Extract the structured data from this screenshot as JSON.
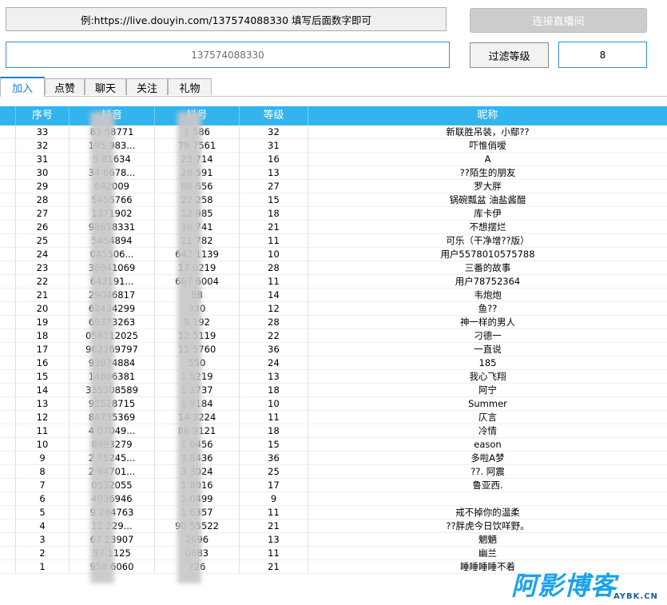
{
  "header": {
    "hint": "例:https://live.douyin.com/137574088330   填写后面数字即可",
    "connect_label": "连接直播间",
    "room_id": "137574088330",
    "filter_label": "过滤等级",
    "filter_level": "8"
  },
  "tabs": [
    {
      "label": "加入",
      "active": true
    },
    {
      "label": "点赞",
      "active": false
    },
    {
      "label": "聊天",
      "active": false
    },
    {
      "label": "关注",
      "active": false
    },
    {
      "label": "礼物",
      "active": false
    }
  ],
  "table": {
    "columns": [
      "序号",
      "抖音",
      "抖号",
      "等级",
      "昵称"
    ],
    "rows": [
      [
        "33",
        "83 58771",
        "1 586",
        "32",
        "新联胜吊装，小鄢??"
      ],
      [
        "32",
        "195 983...",
        "79 7561",
        "31",
        "吓惟俏嗳"
      ],
      [
        "31",
        "9 81634",
        "23 714",
        "16",
        "A"
      ],
      [
        "30",
        "34 6678...",
        "28 591",
        "13",
        "??陌生的朋友"
      ],
      [
        "29",
        "642009",
        "86 656",
        "27",
        "罗大胖"
      ],
      [
        "28",
        "5455766",
        "22 258",
        "15",
        "锅碗瓢盆 油盐酱醋"
      ],
      [
        "27",
        "1371902",
        "12 985",
        "18",
        "库卡伊"
      ],
      [
        "26",
        "98658331",
        "36 741",
        "21",
        "不想摆烂"
      ],
      [
        "25",
        "5454894",
        "21 782",
        "11",
        "可乐（干净增??版）"
      ],
      [
        "24",
        "045506...",
        "642 1139",
        "10",
        "用户5578010575788"
      ],
      [
        "23",
        "36941069",
        "17 0219",
        "28",
        "三番的故事"
      ],
      [
        "22",
        "642191...",
        "667 6004",
        "11",
        "用户78752364"
      ],
      [
        "21",
        "29046817",
        "88",
        "14",
        "韦炮炮"
      ],
      [
        "20",
        "62434299",
        "330",
        "12",
        "鱼??"
      ],
      [
        "19",
        "69373263",
        "9 192",
        "28",
        "神一样的男人"
      ],
      [
        "18",
        "058112025",
        "12 5119",
        "22",
        "刁德一"
      ],
      [
        "17",
        "962269797",
        "11 5760",
        "36",
        "一直说"
      ],
      [
        "16",
        "93974884",
        "550",
        "24",
        "185"
      ],
      [
        "15",
        "14606381",
        "1 5219",
        "13",
        "我心飞翔"
      ],
      [
        "14",
        "335308589",
        "1 1737",
        "18",
        "阿宁"
      ],
      [
        "13",
        "92528715",
        "1 9184",
        "10",
        "Summer"
      ],
      [
        "12",
        "84735369",
        "14 3224",
        "11",
        "仄言"
      ],
      [
        "11",
        "4 07049...",
        "86 9121",
        "18",
        "冷情"
      ],
      [
        "10",
        "8993279",
        "1 0456",
        "15",
        "eason"
      ],
      [
        "9",
        "2 75245...",
        "3 8436",
        "36",
        "多啦A梦"
      ],
      [
        "8",
        "2 94701...",
        "3 3024",
        "25",
        "??. 阿震"
      ],
      [
        "7",
        "0532055",
        "1 8016",
        "17",
        "鲁亚西."
      ],
      [
        "6",
        "4936946",
        "1 0499",
        "9",
        ""
      ],
      [
        "5",
        "9 284763",
        "1 6357",
        "11",
        "戒不掉你的温柔"
      ],
      [
        "4",
        "12 229...",
        "90 55522",
        "21",
        "??胖虎今日饮咩野。"
      ],
      [
        "3",
        "67 23907",
        "2696",
        "13",
        "魍魉"
      ],
      [
        "2",
        "97 1125",
        "0683",
        "11",
        "幽兰"
      ],
      [
        "1",
        "958 6060",
        "726",
        "21",
        "睡睡睡睡不着"
      ]
    ]
  },
  "watermark": {
    "main": "阿影博客",
    "sub": "AYBK.CN"
  }
}
